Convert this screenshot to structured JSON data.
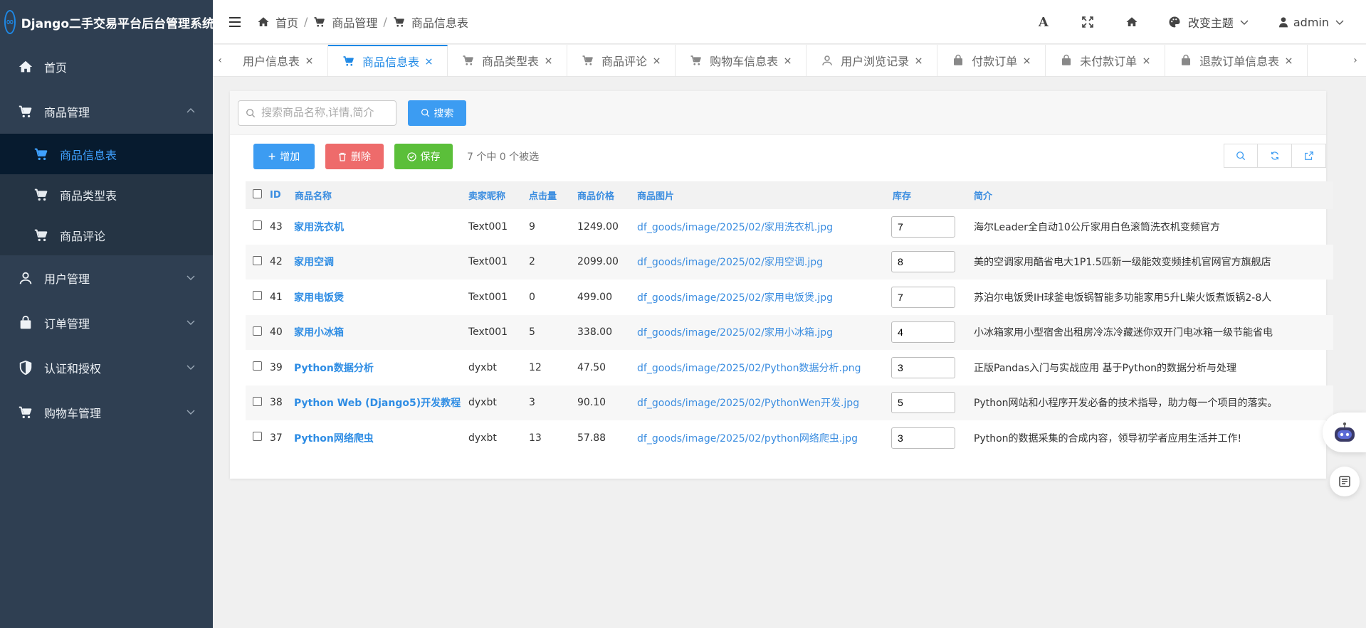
{
  "brand": {
    "title": "Django二手交易平台后台管理系统"
  },
  "sidebar": {
    "items": [
      {
        "label": "首页",
        "icon": "home-icon"
      },
      {
        "label": "商品管理",
        "icon": "cart-icon",
        "expanded": true,
        "children": [
          {
            "label": "商品信息表",
            "icon": "cart-icon",
            "active": true
          },
          {
            "label": "商品类型表",
            "icon": "cart-icon"
          },
          {
            "label": "商品评论",
            "icon": "cart-icon"
          }
        ]
      },
      {
        "label": "用户管理",
        "icon": "user-icon"
      },
      {
        "label": "订单管理",
        "icon": "bag-icon"
      },
      {
        "label": "认证和授权",
        "icon": "shield-icon"
      },
      {
        "label": "购物车管理",
        "icon": "cart-icon"
      }
    ]
  },
  "header": {
    "breadcrumb": [
      "首页",
      "商品管理",
      "商品信息表"
    ],
    "theme_label": "改变主题",
    "user": "admin"
  },
  "tabs": [
    {
      "label": "用户信息表",
      "icon": "user-icon"
    },
    {
      "label": "商品信息表",
      "icon": "cart-icon",
      "active": true
    },
    {
      "label": "商品类型表",
      "icon": "cart-icon"
    },
    {
      "label": "商品评论",
      "icon": "cart-icon"
    },
    {
      "label": "购物车信息表",
      "icon": "cart-icon"
    },
    {
      "label": "用户浏览记录",
      "icon": "user-icon"
    },
    {
      "label": "付款订单",
      "icon": "bag-icon"
    },
    {
      "label": "未付款订单",
      "icon": "bag-icon"
    },
    {
      "label": "退款订单信息表",
      "icon": "bag-icon"
    }
  ],
  "search": {
    "placeholder": "搜索商品名称,详情,简介",
    "button": "搜索"
  },
  "toolbar": {
    "add": "增加",
    "delete": "删除",
    "save": "保存",
    "selection": "7 个中 0 个被选"
  },
  "table": {
    "headers": [
      "ID",
      "商品名称",
      "卖家昵称",
      "点击量",
      "商品价格",
      "商品图片",
      "库存",
      "简介"
    ],
    "rows": [
      {
        "id": "43",
        "name": "家用洗衣机",
        "seller": "Text001",
        "clicks": "9",
        "price": "1249.00",
        "image": "df_goods/image/2025/02/家用洗衣机.jpg",
        "stock": "7",
        "intro": "海尔Leader全自动10公斤家用白色滚筒洗衣机变频官方"
      },
      {
        "id": "42",
        "name": "家用空调",
        "seller": "Text001",
        "clicks": "2",
        "price": "2099.00",
        "image": "df_goods/image/2025/02/家用空调.jpg",
        "stock": "8",
        "intro": "美的空调家用酷省电大1P1.5匹新一级能效变频挂机官网官方旗舰店"
      },
      {
        "id": "41",
        "name": "家用电饭煲",
        "seller": "Text001",
        "clicks": "0",
        "price": "499.00",
        "image": "df_goods/image/2025/02/家用电饭煲.jpg",
        "stock": "7",
        "intro": "苏泊尔电饭煲IH球釜电饭锅智能多功能家用5升L柴火饭煮饭锅2-8人"
      },
      {
        "id": "40",
        "name": "家用小冰箱",
        "seller": "Text001",
        "clicks": "5",
        "price": "338.00",
        "image": "df_goods/image/2025/02/家用小冰箱.jpg",
        "stock": "4",
        "intro": "小冰箱家用小型宿舍出租房冷冻冷藏迷你双开门电冰箱一级节能省电"
      },
      {
        "id": "39",
        "name": "Python数据分析",
        "seller": "dyxbt",
        "clicks": "12",
        "price": "47.50",
        "image": "df_goods/image/2025/02/Python数据分析.png",
        "stock": "3",
        "intro": "正版Pandas入门与实战应用 基于Python的数据分析与处理"
      },
      {
        "id": "38",
        "name": "Python Web (Django5)开发教程",
        "seller": "dyxbt",
        "clicks": "3",
        "price": "90.10",
        "image": "df_goods/image/2025/02/PythonWen开发.jpg",
        "stock": "5",
        "intro": "Python网站和小程序开发必备的技术指导，助力每一个项目的落实。"
      },
      {
        "id": "37",
        "name": "Python网络爬虫",
        "seller": "dyxbt",
        "clicks": "13",
        "price": "57.88",
        "image": "df_goods/image/2025/02/python网络爬虫.jpg",
        "stock": "3",
        "intro": "Python的数据采集的合成内容，领导初学者应用生活并工作!"
      }
    ]
  },
  "colors": {
    "accent": "#1e88e5",
    "sidebar_bg": "#2f3f52",
    "sidebar_active_bg": "#071b2f"
  }
}
